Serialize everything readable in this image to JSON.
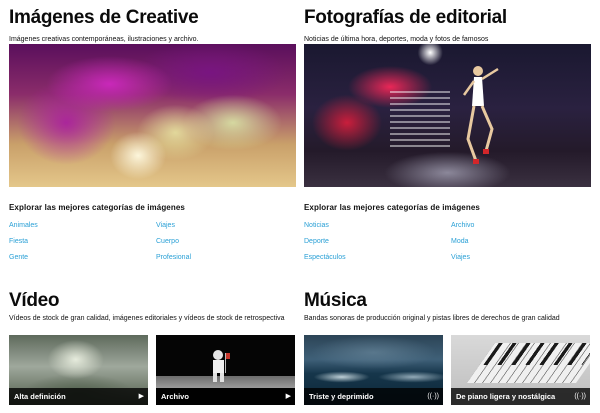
{
  "creative": {
    "title": "Imágenes de Creative",
    "subtitle": "Imágenes creativas contemporáneas, ilustraciones y archivo.",
    "explore_heading": "Explorar las mejores categorías de imágenes",
    "links": [
      "Animales",
      "Viajes",
      "Fiesta",
      "Cuerpo",
      "Gente",
      "Profesional"
    ]
  },
  "editorial": {
    "title": "Fotografías de editorial",
    "subtitle": "Noticias de última hora, deportes, moda y fotos de famosos",
    "explore_heading": "Explorar las mejores categorías de imágenes",
    "links": [
      "Noticias",
      "Archivo",
      "Deporte",
      "Moda",
      "Espectáculos",
      "Viajes"
    ]
  },
  "video": {
    "title": "Vídeo",
    "subtitle": "Vídeos de stock de gran calidad, imágenes editoriales y vídeos de stock de retrospectiva",
    "thumbs": [
      {
        "label": "Alta definición",
        "icon": "play-icon"
      },
      {
        "label": "Archivo",
        "icon": "play-icon"
      }
    ]
  },
  "music": {
    "title": "Música",
    "subtitle": "Bandas sonoras de producción original y pistas libres de derechos de gran calidad",
    "thumbs": [
      {
        "label": "Triste y deprimido",
        "icon": "audio-icon"
      },
      {
        "label": "De piano ligera y nostálgica",
        "icon": "audio-icon"
      }
    ]
  },
  "colors": {
    "link": "#2aa0d6",
    "text": "#111111",
    "label_bg": "#000000"
  }
}
